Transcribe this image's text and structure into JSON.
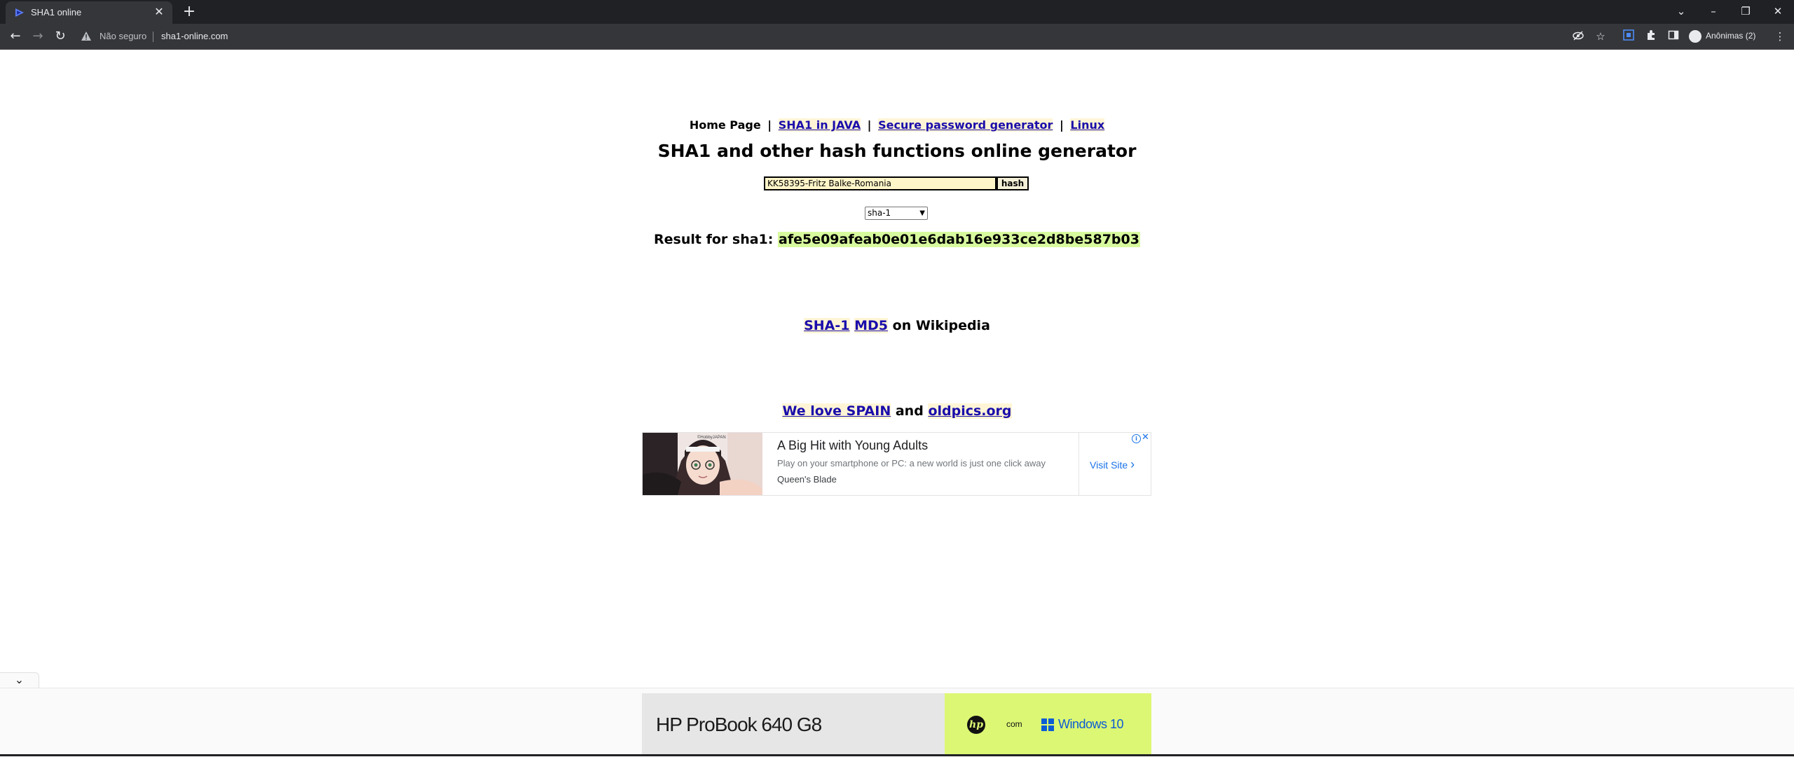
{
  "browser": {
    "tab_title": "SHA1 online",
    "new_tab_symbol": "+",
    "tab_close_symbol": "✕",
    "security_label": "Não seguro",
    "url": "sha1-online.com",
    "profile_label": "Anônimas (2)",
    "nav": {
      "back": "←",
      "forward": "→",
      "reload": "↻"
    },
    "window_controls": {
      "tab_search": "⌄",
      "minimize": "–",
      "restore": "❐",
      "close": "✕"
    },
    "toolbar_icons": [
      "eye-off-icon",
      "star-icon",
      "extension-icon",
      "puzzle-icon",
      "side-panel-icon",
      "menu-icon"
    ]
  },
  "page": {
    "nav": {
      "home": "Home Page",
      "separator": "|",
      "links": [
        "SHA1 in JAVA",
        "Secure password generator",
        "Linux"
      ]
    },
    "title": "SHA1 and other hash functions online generator",
    "form": {
      "input_value": "KK58395-Fritz Balke-Romania",
      "button_label": "hash",
      "algorithm": "sha-1"
    },
    "result": {
      "label": "Result for sha1:",
      "hash": "afe5e09afeab0e01e6dab16e933ce2d8be587b03"
    },
    "wiki": {
      "link1": "SHA-1",
      "link2": "MD5",
      "suffix": "on Wikipedia"
    },
    "promo": {
      "link1": "We love SPAIN",
      "middle": "and",
      "link2": "oldpics.org"
    }
  },
  "ad": {
    "title": "A Big Hit with Young Adults",
    "description": "Play on your smartphone or PC: a new world is just one click away",
    "source": "Queen's Blade",
    "cta": "Visit Site",
    "cta_chevron": "›",
    "info_symbol": "i",
    "close_symbol": "✕",
    "image_caption": "©HobbyJAPAN"
  },
  "anchor_ad": {
    "toggle_symbol": "⌄",
    "title": "HP ProBook 640 G8",
    "hp_logo": "hp",
    "with": "com",
    "windows_label": "Windows 10"
  },
  "colors": {
    "chrome_dark": "#202124",
    "chrome_toolbar": "#35363a",
    "link": "#1a0dab",
    "hash_highlight": "#d8fa9e",
    "input_bg": "#fff5c8",
    "anchor_green": "#dcf774",
    "windows_blue": "#0b5cd5"
  }
}
